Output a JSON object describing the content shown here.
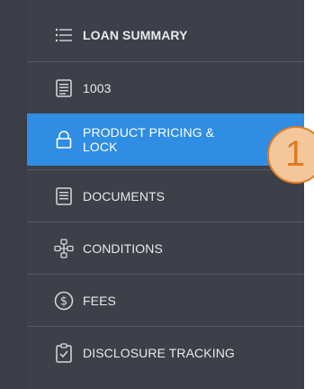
{
  "nav": {
    "items": [
      {
        "label": "LOAN SUMMARY",
        "icon": "list-icon"
      },
      {
        "label": "1003",
        "icon": "form-icon"
      },
      {
        "label": "PRODUCT PRICING & LOCK",
        "icon": "lock-icon"
      },
      {
        "label": "DOCUMENTS",
        "icon": "document-icon"
      },
      {
        "label": "CONDITIONS",
        "icon": "conditions-network-icon"
      },
      {
        "label": "FEES",
        "icon": "dollar-circle-icon"
      },
      {
        "label": "DISCLOSURE TRACKING",
        "icon": "clipboard-check-icon"
      }
    ],
    "active_index": 2
  },
  "callout": {
    "number": "1"
  },
  "colors": {
    "sidebar_bg": "#3d4048",
    "active_bg": "#2f8de4",
    "callout_border": "#e07b22",
    "callout_fill": "#f4c79a"
  }
}
